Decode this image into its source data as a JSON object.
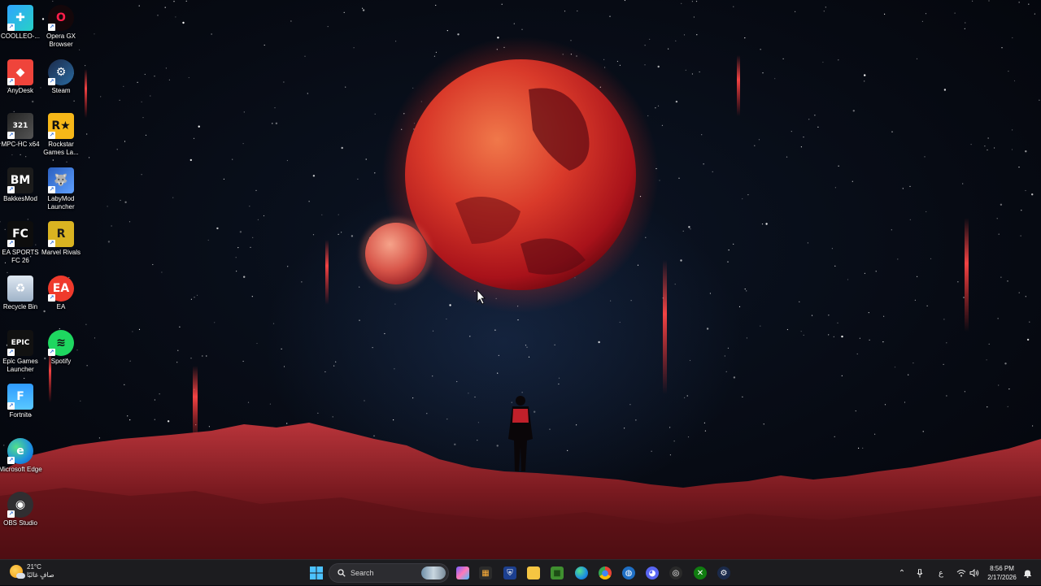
{
  "desktop": {
    "icons_col1": [
      {
        "name": "coolleo",
        "label": "COOLLEO-...",
        "icon": "coolleo-icon"
      },
      {
        "name": "anydesk",
        "label": "AnyDesk",
        "icon": "anydesk-icon"
      },
      {
        "name": "mpc-hc",
        "label": "MPC-HC x64",
        "icon": "mpc-hc-icon"
      },
      {
        "name": "bakkesmod",
        "label": "BakkesMod",
        "icon": "bakkesmod-icon"
      },
      {
        "name": "ea-sports-fc",
        "label": "EA SPORTS FC 26",
        "icon": "ea-sports-fc-icon"
      },
      {
        "name": "recycle-bin",
        "label": "Recycle Bin",
        "icon": "recycle-bin-icon"
      },
      {
        "name": "epic-games",
        "label": "Epic Games Launcher",
        "icon": "epic-games-icon"
      },
      {
        "name": "fortnite",
        "label": "Fortnite",
        "icon": "fortnite-icon"
      },
      {
        "name": "microsoft-edge",
        "label": "Microsoft Edge",
        "icon": "edge-icon"
      },
      {
        "name": "obs-studio",
        "label": "OBS Studio",
        "icon": "obs-icon"
      }
    ],
    "icons_col2": [
      {
        "name": "opera-gx",
        "label": "Opera GX Browser",
        "icon": "opera-gx-icon"
      },
      {
        "name": "steam",
        "label": "Steam",
        "icon": "steam-icon"
      },
      {
        "name": "rockstar",
        "label": "Rockstar Games La...",
        "icon": "rockstar-icon"
      },
      {
        "name": "labymod",
        "label": "LabyMod Launcher",
        "icon": "labymod-icon"
      },
      {
        "name": "marvel-rivals",
        "label": "Marvel Rivals",
        "icon": "marvel-rivals-icon"
      },
      {
        "name": "ea",
        "label": "EA",
        "icon": "ea-icon"
      },
      {
        "name": "spotify",
        "label": "Spotify",
        "icon": "spotify-icon"
      }
    ]
  },
  "taskbar": {
    "weather": {
      "temp": "21°C",
      "condition": "صافٍ غالبًا",
      "icon": "weather-sun-icon"
    },
    "search_placeholder": "Search",
    "pinned": [
      {
        "name": "copilot",
        "icon": "copilot-icon"
      },
      {
        "name": "microsoft-store",
        "icon": "store-icon"
      },
      {
        "name": "vpn-shield",
        "icon": "shield-icon"
      },
      {
        "name": "file-explorer",
        "icon": "folder-icon"
      },
      {
        "name": "minecraft",
        "icon": "minecraft-icon"
      },
      {
        "name": "edge",
        "icon": "edge-icon"
      },
      {
        "name": "chrome",
        "icon": "chrome-icon"
      },
      {
        "name": "browser-alt",
        "icon": "globe-icon"
      },
      {
        "name": "discord",
        "icon": "discord-icon"
      },
      {
        "name": "app-opera",
        "icon": "opera-icon"
      },
      {
        "name": "xbox",
        "icon": "xbox-icon"
      },
      {
        "name": "steam",
        "icon": "steam-icon"
      }
    ],
    "tray": {
      "lang": "ع",
      "time": "8:56 PM",
      "date": "2/17/2026"
    }
  }
}
